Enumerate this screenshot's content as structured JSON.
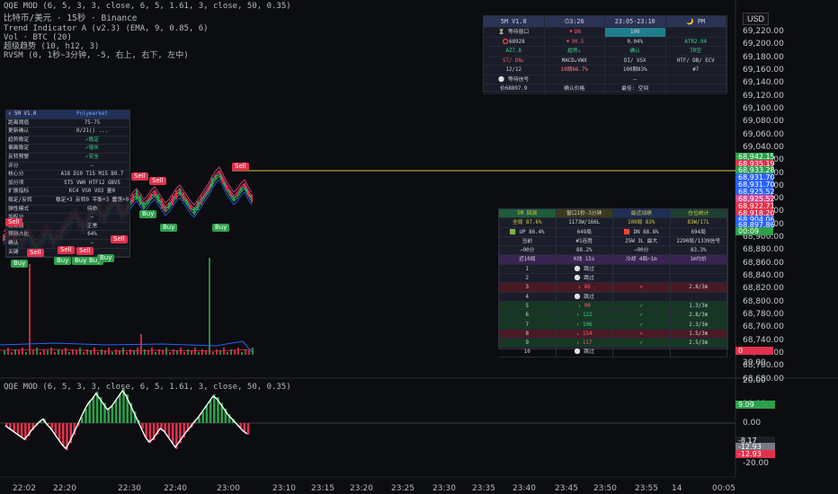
{
  "chart_header": {
    "line0": "QQE MOD (6, 5, 3, 3, close, 6, 5, 1.61, 3, close, 50, 0.35)",
    "line1": "比特币/美元 · 15秒 · Binance",
    "line2": "Trend Indicator A (v2.3) (EMA, 9, 0.85, 6)",
    "line3": "Vol · BTC (20)",
    "line4": "超级趋势 (10, h12, 3)",
    "line5": "RVSM (0, 1秒~3分钟, -5, 右上, 右下, 左中)"
  },
  "oscillator_title": "QQE MOD (6, 5, 3, 3, close, 6, 5, 1.61, 3, close, 50, 0.35)",
  "currency": "USD",
  "price_axis": [
    "69,220.00",
    "69,200.00",
    "69,180.00",
    "69,160.00",
    "69,140.00",
    "69,120.00",
    "69,100.00",
    "69,080.00",
    "69,060.00",
    "69,040.00",
    "69,020.00",
    "69,000.00",
    "68,980.00",
    "68,960.00",
    "68,940.00",
    "68,920.00",
    "68,900.00",
    "68,880.00",
    "68,860.00",
    "68,840.00",
    "68,820.00",
    "68,800.00",
    "68,780.00",
    "68,760.00",
    "68,740.00",
    "68,720.00",
    "68,700.00",
    "68,680.00"
  ],
  "price_tags": [
    {
      "text": "68,942.15",
      "color": "#2da04b"
    },
    {
      "text": "68,935.19",
      "color": "#e0314d"
    },
    {
      "text": "68,933.28",
      "color": "#2da04b"
    },
    {
      "text": "68,931.70",
      "color": "#2962ff"
    },
    {
      "text": "68,931.70",
      "color": "#2962ff"
    },
    {
      "text": "68,925.52",
      "color": "#2962ff"
    },
    {
      "text": "68,925.52",
      "color": "#d84b8c"
    },
    {
      "text": "68,922.71",
      "color": "#e0314d"
    },
    {
      "text": "68,918.20",
      "color": "#e0314d"
    },
    {
      "text": "68,904.06",
      "color": "#2962ff"
    },
    {
      "text": "68,897.86",
      "color": "#2962ff"
    },
    {
      "text": "00:09",
      "color": "#2da04b"
    },
    {
      "text": "0",
      "color": "#e0314d"
    }
  ],
  "osc_axis": [
    "30.00",
    "20.00",
    "10.00",
    "0.00",
    "-10.00",
    "-20.00"
  ],
  "osc_tags": [
    {
      "text": "9.09",
      "color": "#2da04b"
    },
    {
      "text": "-8.17",
      "color": "#1d1f26"
    },
    {
      "text": "-12.93",
      "color": "#777a82"
    },
    {
      "text": "-12.93",
      "color": "#e0314d"
    }
  ],
  "time_axis": [
    "22:02",
    "22:20",
    "22:30",
    "22:40",
    "23:00",
    "23:10",
    "23:15",
    "23:20",
    "23:25",
    "23:30",
    "23:35",
    "23:40",
    "23:45",
    "23:50",
    "23:55",
    "14",
    "00:05"
  ],
  "signals": {
    "sell": [
      "Sell",
      "Sell",
      "Sell",
      "Sell",
      "Sell",
      "Sell",
      "Sell",
      "Sell"
    ],
    "buy": [
      "Buy",
      "Buy",
      "Buy",
      "Buy",
      "Buy",
      "Buy",
      "Buy",
      "Buy"
    ]
  },
  "panel_top": {
    "rows": [
      [
        "5M V1.0",
        "⏱3:26",
        "23:05-23:10",
        "🌙 PM"
      ],
      [
        "⏳ 等待窗口",
        "🔻DN",
        "100",
        ""
      ],
      [
        "⭕68928",
        "🔻30.5",
        "0.04%",
        "ATR2.94"
      ],
      [
        "AZ7.8",
        "趋势↓",
        "确认",
        "TR空"
      ],
      [
        "ST/ DN↙",
        "MACD↙VWX",
        "DI/ VSX",
        "HTF/ DB/ ECV"
      ],
      [
        "12/12",
        "10期66.7%",
        "100期83%",
        "#7"
      ],
      [
        "⚪ 等待信号",
        "",
        "—",
        ""
      ],
      [
        "价68897.9",
        "确认价格",
        "最佳: 空间",
        ""
      ]
    ]
  },
  "panel_left": {
    "rows": [
      [
        "⚡ 5M V1.0",
        "Polymarket"
      ],
      [
        "距离阈值",
        "75-75"
      ],
      [
        "更新确认",
        "0/21() ..."
      ],
      [
        "趋势稳定",
        "✓稳定"
      ],
      [
        "偏离稳定",
        "✓增长"
      ],
      [
        "反转预警",
        "✓安全"
      ],
      [
        "评分",
        "—"
      ],
      [
        "核心分",
        "A18 D10 T15 M15 B9.7"
      ],
      [
        "加分项",
        "ST5 VW0 HTF12 OBV5"
      ],
      [
        "扩展指标",
        "KC4 VS0 VO3 量0"
      ],
      [
        "稳定/反转",
        "稳定+3 反转0 平衡+3 震荡+0"
      ],
      [
        "弹性模式",
        "待命"
      ],
      [
        "加权分",
        "—"
      ],
      [
        "过滤器",
        "正常"
      ],
      [
        "预测占比",
        "64%"
      ],
      [
        "确认",
        "—"
      ],
      [
        "关键",
        "—"
      ]
    ]
  },
  "panel_bottom": {
    "rows": [
      [
        "5M 回测",
        "窗口1秒-3分钟",
        "最近战绩",
        "仓位统计"
      ],
      [
        "全局 87.6%",
        "1173W/166L",
        "100局 83%",
        "83W/17L"
      ],
      [
        "🟩 UP 86.4%",
        "649局",
        "🟥 DN 88.8%",
        "694局"
      ],
      [
        "当前",
        "#1连胜",
        "25W 3L 最大",
        "2290局/1339信号"
      ],
      [
        "→90分",
        "88.2%",
        "→90分",
        "83.3%"
      ],
      [
        "近10局",
        "K线 15s",
        "冷却 4局~1m",
        "1m均价"
      ],
      [
        "1",
        "⚪ 跳过",
        "",
        ""
      ],
      [
        "2",
        "⚪ 跳过",
        "",
        ""
      ],
      [
        "3",
        "↓ 86",
        "✕",
        "2.8/3m"
      ],
      [
        "4",
        "⚪ 跳过",
        "",
        ""
      ],
      [
        "5",
        "↓ 90",
        "✓",
        "1.3/3m"
      ],
      [
        "6",
        "↑ 122",
        "✓",
        "2.8/3m"
      ],
      [
        "7",
        "↑ 106",
        "✓",
        "2.3/3m"
      ],
      [
        "8",
        "↓ 154",
        "✕",
        "1.5/3m"
      ],
      [
        "9",
        "↓ 117",
        "✓",
        "2.5/3m"
      ],
      [
        "10",
        "⚪ 跳过",
        "",
        ""
      ]
    ]
  },
  "colors": {
    "green": "#2da04b",
    "red": "#e0314d",
    "blue": "#2962ff",
    "yellow": "#d2c64a",
    "bg": "#0c0d10"
  }
}
